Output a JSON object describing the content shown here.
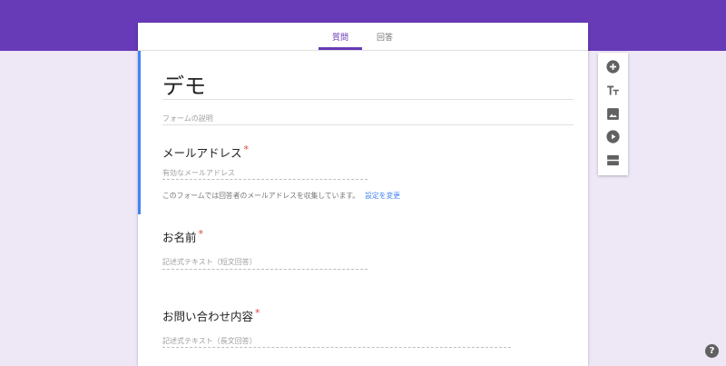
{
  "tabs": [
    {
      "label": "質問",
      "active": true
    },
    {
      "label": "回答",
      "active": false
    }
  ],
  "form": {
    "title": "デモ",
    "description_placeholder": "フォームの説明"
  },
  "questions": [
    {
      "label": "メールアドレス",
      "required_mark": "*",
      "answer_placeholder": "有効なメールアドレス"
    },
    {
      "label": "お名前",
      "required_mark": "*",
      "answer_placeholder": "記述式テキスト（短文回答）"
    },
    {
      "label": "お問い合わせ内容",
      "required_mark": "*",
      "answer_placeholder": "記述式テキスト（長文回答）"
    }
  ],
  "email_note": {
    "text": "このフォームでは回答者のメールアドレスを収集しています。",
    "link": "設定を変更"
  },
  "toolbar": {
    "items": [
      "add-question-icon",
      "add-title-icon",
      "add-image-icon",
      "add-video-icon",
      "add-section-icon"
    ]
  },
  "help_label": "?",
  "colors": {
    "theme": "#673ab7",
    "background": "#ede7f6",
    "active_bar": "#4285f4",
    "required": "#db4437"
  }
}
